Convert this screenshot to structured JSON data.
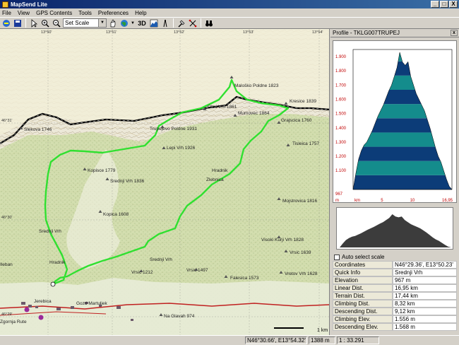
{
  "window": {
    "title": "MapSend Lite",
    "min": "_",
    "max": "□",
    "close": "X"
  },
  "menu": [
    "File",
    "View",
    "GPS Contents",
    "Tools",
    "Preferences",
    "Help"
  ],
  "toolbar": {
    "scale_select": "Set Scale",
    "btn_3d": "3D"
  },
  "map": {
    "lon_labels": [
      "13°50'",
      "13°51'",
      "13°52'",
      "13°53'",
      "13°54'"
    ],
    "lat_labels": [
      "46°31'",
      "46°30'",
      "46°29'"
    ],
    "scale_bar": "1 km",
    "places": [
      {
        "name": "Maloško Poldne 1823"
      },
      {
        "name": "Oltni Vrh 1861"
      },
      {
        "name": "Kresice 1839"
      },
      {
        "name": "Mumovec 1864"
      },
      {
        "name": "Grajscica 1760"
      },
      {
        "name": "Slekova 1746"
      },
      {
        "name": "Trupejevo Poldne 1931"
      },
      {
        "name": "Tisleica 1757"
      },
      {
        "name": "Lepi Vrh 1926"
      },
      {
        "name": "Kopisce 1779"
      },
      {
        "name": "Srednji Vrh 1836"
      },
      {
        "name": "Hradnik"
      },
      {
        "name": "Zlebnica"
      },
      {
        "name": "Mojstrovica 1816"
      },
      {
        "name": "Kopica 1608"
      },
      {
        "name": "Srednji Vrh"
      },
      {
        "name": "Visoki Kurji Vrh 1828"
      },
      {
        "name": "Vrsic 1639"
      },
      {
        "name": "Hradnik"
      },
      {
        "name": "Srednji Vrh"
      },
      {
        "name": "Vrsic 1212"
      },
      {
        "name": "Vrsic 1497"
      },
      {
        "name": "Falesica 1573"
      },
      {
        "name": "Vretov Vrh 1628"
      },
      {
        "name": "Na Glavah 974"
      },
      {
        "name": "Jerebica"
      },
      {
        "name": "Gozd Martuljek"
      },
      {
        "name": "Zgornja Rute"
      },
      {
        "name": "Ileban"
      }
    ]
  },
  "profile": {
    "title": "Profile - TKLG007TRUPEJ",
    "close": "x",
    "y_ticks": [
      "1.900",
      "1.800",
      "1.700",
      "1.600",
      "1.500",
      "1.400",
      "1.300",
      "1.200",
      "1.100"
    ],
    "y_min_label": "967",
    "y_unit": "m",
    "x_unit": "km",
    "x_ticks": [
      "5",
      "10",
      "16,95"
    ],
    "colors": {
      "dark": "#0c3c78",
      "teal": "#148c8c",
      "overview": "#3c3c3c"
    },
    "elevation_profile": [
      967,
      1080,
      1180,
      1240,
      1280,
      1300,
      1340,
      1380,
      1430,
      1480,
      1520,
      1560,
      1610,
      1660,
      1700,
      1760,
      1823,
      1930,
      1861,
      1839,
      1864,
      1760,
      1700,
      1640,
      1600,
      1560,
      1520,
      1460,
      1400,
      1330,
      1260,
      1200,
      1160,
      1100,
      1040,
      990,
      967
    ]
  },
  "auto_select": "Auto select scale",
  "info": [
    {
      "key": "Coordinates",
      "value": "N46°29.36', E13°50.23'"
    },
    {
      "key": "Quick Info",
      "value": "Srednji Vrh"
    },
    {
      "key": "Elevation",
      "value": "967 m"
    },
    {
      "key": "Linear Dist.",
      "value": "16,95 km"
    },
    {
      "key": "Terrain Dist.",
      "value": "17,44 km"
    },
    {
      "key": "Climbing Dist.",
      "value": "8,32 km"
    },
    {
      "key": "Descending Dist.",
      "value": "9,12 km"
    },
    {
      "key": "Climbing Elev.",
      "value": "1.556 m"
    },
    {
      "key": "Descending Elev.",
      "value": "1.568 m"
    }
  ],
  "status": {
    "coords": "N46°30.66', E13°54.32'",
    "elev": "1388 m",
    "scale": "1 : 33.291"
  }
}
